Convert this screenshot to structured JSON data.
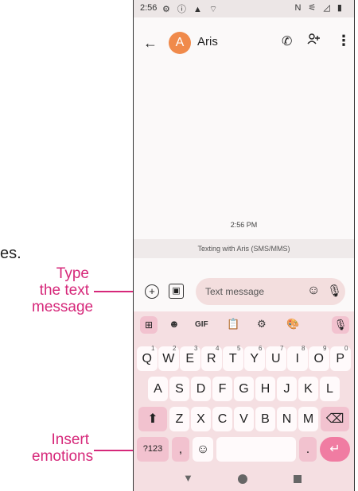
{
  "outside": {
    "cut_text": "es.",
    "callout_type": "Type\nthe text\nmessage",
    "callout_insert": "Insert\nemotions"
  },
  "status_bar": {
    "time": "2:56",
    "left_icons": "⚙ ⓘ ▲ ⌔",
    "right_icons": "N ⚟ ◿ ▮"
  },
  "header": {
    "back_icon": "back-arrow-icon",
    "avatar_letter": "A",
    "contact_name": "Aris",
    "avatar_color": "#f08a4b"
  },
  "conversation": {
    "timestamp": "2:56 PM",
    "info": "Texting with Aris (SMS/MMS)"
  },
  "compose": {
    "placeholder": "Text message"
  },
  "keyboard": {
    "toolbar": [
      "GIF"
    ],
    "row1": [
      {
        "k": "Q",
        "n": "1"
      },
      {
        "k": "W",
        "n": "2"
      },
      {
        "k": "E",
        "n": "3"
      },
      {
        "k": "R",
        "n": "4"
      },
      {
        "k": "T",
        "n": "5"
      },
      {
        "k": "Y",
        "n": "6"
      },
      {
        "k": "U",
        "n": "7"
      },
      {
        "k": "I",
        "n": "8"
      },
      {
        "k": "O",
        "n": "9"
      },
      {
        "k": "P",
        "n": "0"
      }
    ],
    "row2": [
      "A",
      "S",
      "D",
      "F",
      "G",
      "H",
      "J",
      "K",
      "L"
    ],
    "row3": [
      "Z",
      "X",
      "C",
      "V",
      "B",
      "N",
      "M"
    ],
    "symbols_key": "?123",
    "comma_key": ",",
    "period_key": ".",
    "accent_color": "#f07ca2"
  }
}
